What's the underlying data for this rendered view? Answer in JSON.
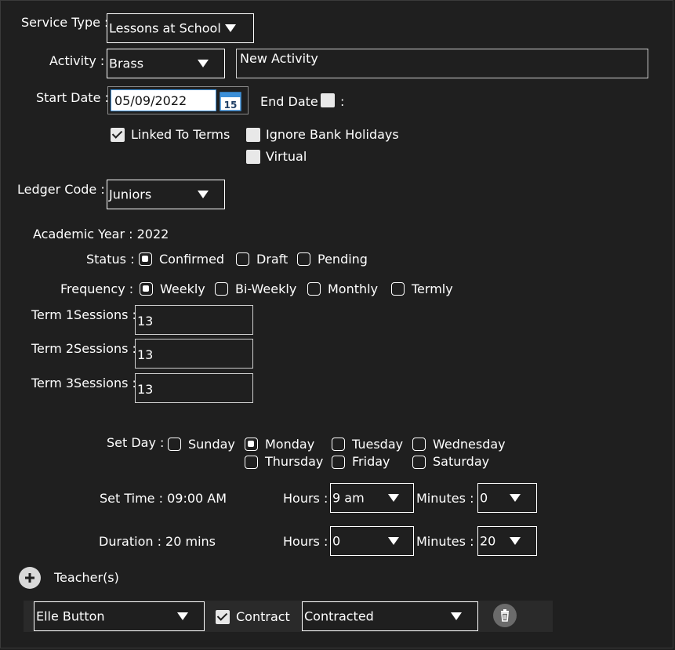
{
  "service_type": {
    "label": "Service Type :",
    "value": "Lessons at School"
  },
  "activity": {
    "label": "Activity :",
    "value": "Brass",
    "name_value": "New Activity"
  },
  "start_date": {
    "label": "Start Date :",
    "value": "05/09/2022",
    "calendar_day": "15"
  },
  "end_date": {
    "label": "End Date",
    "suffix": ":"
  },
  "options": {
    "linked_to_terms": {
      "label": "Linked To Terms",
      "checked": true
    },
    "ignore_bank_holidays": {
      "label": "Ignore Bank Holidays",
      "checked": false
    },
    "virtual": {
      "label": "Virtual",
      "checked": false
    }
  },
  "ledger_code": {
    "label": "Ledger Code :",
    "value": "Juniors"
  },
  "academic_year": {
    "label": "Academic Year : 2022"
  },
  "status": {
    "label": "Status :",
    "options": [
      "Confirmed",
      "Draft",
      "Pending"
    ],
    "selected": "Confirmed"
  },
  "frequency": {
    "label": "Frequency :",
    "options": [
      "Weekly",
      "Bi-Weekly",
      "Monthly",
      "Termly"
    ],
    "selected": "Weekly"
  },
  "terms": [
    {
      "label": "Term 1Sessions :",
      "value": "13"
    },
    {
      "label": "Term 2Sessions :",
      "value": "13"
    },
    {
      "label": "Term 3Sessions :",
      "value": "13"
    }
  ],
  "set_day": {
    "label": "Set Day :",
    "days": [
      "Sunday",
      "Monday",
      "Tuesday",
      "Wednesday",
      "Thursday",
      "Friday",
      "Saturday"
    ],
    "selected": "Monday"
  },
  "set_time": {
    "label": "Set Time : 09:00 AM",
    "hours_label": "Hours :",
    "hours_value": "9 am",
    "minutes_label": "Minutes :",
    "minutes_value": "0"
  },
  "duration": {
    "label": "Duration : 20 mins",
    "hours_label": "Hours :",
    "hours_value": "0",
    "minutes_label": "Minutes :",
    "minutes_value": "20"
  },
  "teachers": {
    "label": "Teacher(s)",
    "rows": [
      {
        "name": "Elle Button",
        "contract_label": "Contract",
        "contract_checked": true,
        "contract_type": "Contracted"
      }
    ]
  },
  "colors": {
    "background": "#1f1f1f",
    "text": "#ffffff",
    "accent": "#3c8fd8"
  }
}
